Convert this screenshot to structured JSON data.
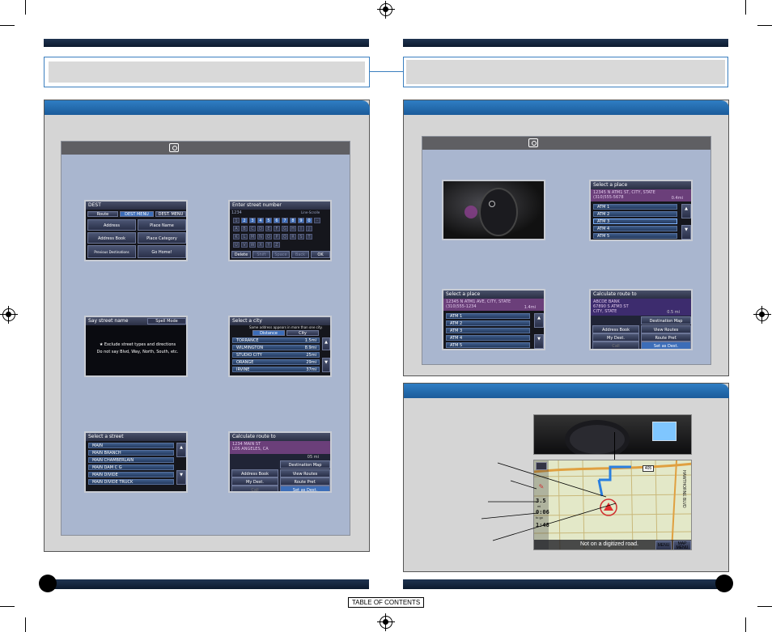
{
  "footer": {
    "toc_label": "TABLE OF CONTENTS"
  },
  "left_steps": {
    "screen1": {
      "title": "DEST",
      "tabs": [
        "Route",
        "DEST MENU",
        "DEST. MENU"
      ],
      "buttons": [
        "Address",
        "Place Name",
        "Address Book",
        "Place Category",
        "Previous Destinations",
        "Go Home!"
      ]
    },
    "screen2": {
      "title": "Enter street number",
      "input_value": "1234",
      "input_hint": "Line-Scrolle",
      "keys_row1": [
        "1",
        "2",
        "3",
        "4",
        "5",
        "6",
        "7",
        "8",
        "9",
        "0",
        "-"
      ],
      "keys_row2": [
        "A",
        "B",
        "C",
        "D",
        "E",
        "F",
        "G",
        "H",
        "I",
        "J"
      ],
      "keys_row3": [
        "K",
        "L",
        "M",
        "N",
        "O",
        "P",
        "Q",
        "R",
        "S",
        "T"
      ],
      "keys_row4": [
        "U",
        "V",
        "W",
        "X",
        "Y",
        "Z"
      ],
      "bottom_keys": [
        "Delete",
        "Shift",
        "Space",
        "Back",
        "OK"
      ]
    },
    "screen3": {
      "title": "Say street name",
      "badge": "Spell Mode",
      "line1": "★ Exclude street types and directions",
      "line2": "Do not say Blvd, Way, North, South, etc."
    },
    "screen4": {
      "title": "Select a city",
      "note": "Same address appears in more than one city.",
      "sort_tabs": [
        "Distance",
        "City"
      ],
      "rows": [
        {
          "name": "TORRANCE",
          "dist": "1.5mi"
        },
        {
          "name": "WILMINGTON",
          "dist": "8.9mi"
        },
        {
          "name": "STUDIO CITY",
          "dist": "25mi"
        },
        {
          "name": "ORANGE",
          "dist": "29mi"
        },
        {
          "name": "IRVINE",
          "dist": "37mi"
        }
      ]
    },
    "screen5": {
      "title": "Select a street",
      "rows": [
        "MAIN",
        "MAIN BRANCH",
        "MAIN CHAMBERLAIN",
        "MAIN DAM C G",
        "MAIN DIVIDE",
        "MAIN DIVIDE TRUCK"
      ]
    },
    "screen6": {
      "title": "Calculate route to",
      "addr1": "1234 MAIN ST",
      "addr2": "LOS ANGELES, CA",
      "dist": "05 mi",
      "buttons": [
        "Destination Map",
        "Address Book",
        "View Routes",
        "My Dest.",
        "Route Pref.",
        "Call",
        "Set as Dest."
      ]
    }
  },
  "right_steps": {
    "screenA": {
      "title": "Select a place",
      "addr1": "12345 N ATM1 ST, CITY, STATE",
      "addr2": "(310)555-5678",
      "dist": "0.4mi",
      "rows": [
        "ATM 1",
        "ATM 2",
        "ATM 3",
        "ATM 4",
        "ATM 5"
      ]
    },
    "screenB": {
      "title": "Select a place",
      "addr1": "12345 N ATM1 AVE, CITY, STATE",
      "addr2": "(310)555-1234",
      "dist": "1.4mi",
      "rows": [
        "ATM 1",
        "ATM 2",
        "ATM 3",
        "ATM 4",
        "ATM 5"
      ]
    },
    "screenC": {
      "title": "Calculate route to",
      "addr1": "ABCDE BANK",
      "addr2": "67890 S ATM3 ST",
      "addr3": "CITY, STATE",
      "dist": "0.5 mi",
      "buttons": [
        "Destination Map",
        "Address Book",
        "View Routes",
        "My Dest.",
        "Route Pref.",
        "Call",
        "Set as Dest."
      ]
    }
  },
  "map_screen": {
    "status": "Not on a digitized road.",
    "menu_btn": "MENU",
    "map_menu_btn": "MAP MENU",
    "dist_readout": "3.5",
    "dist_unit": "mi",
    "time_readout": "0:06",
    "time_unit": "to go",
    "clock": "1:48",
    "street_label": "HAWTHORNE BLVD",
    "road_shield": "405"
  },
  "colors": {
    "accent_blue": "#2f7ec4",
    "navy": "#0c1a2e",
    "step_bg": "#a9b6cf",
    "panel_bg": "#d5d5d5"
  }
}
